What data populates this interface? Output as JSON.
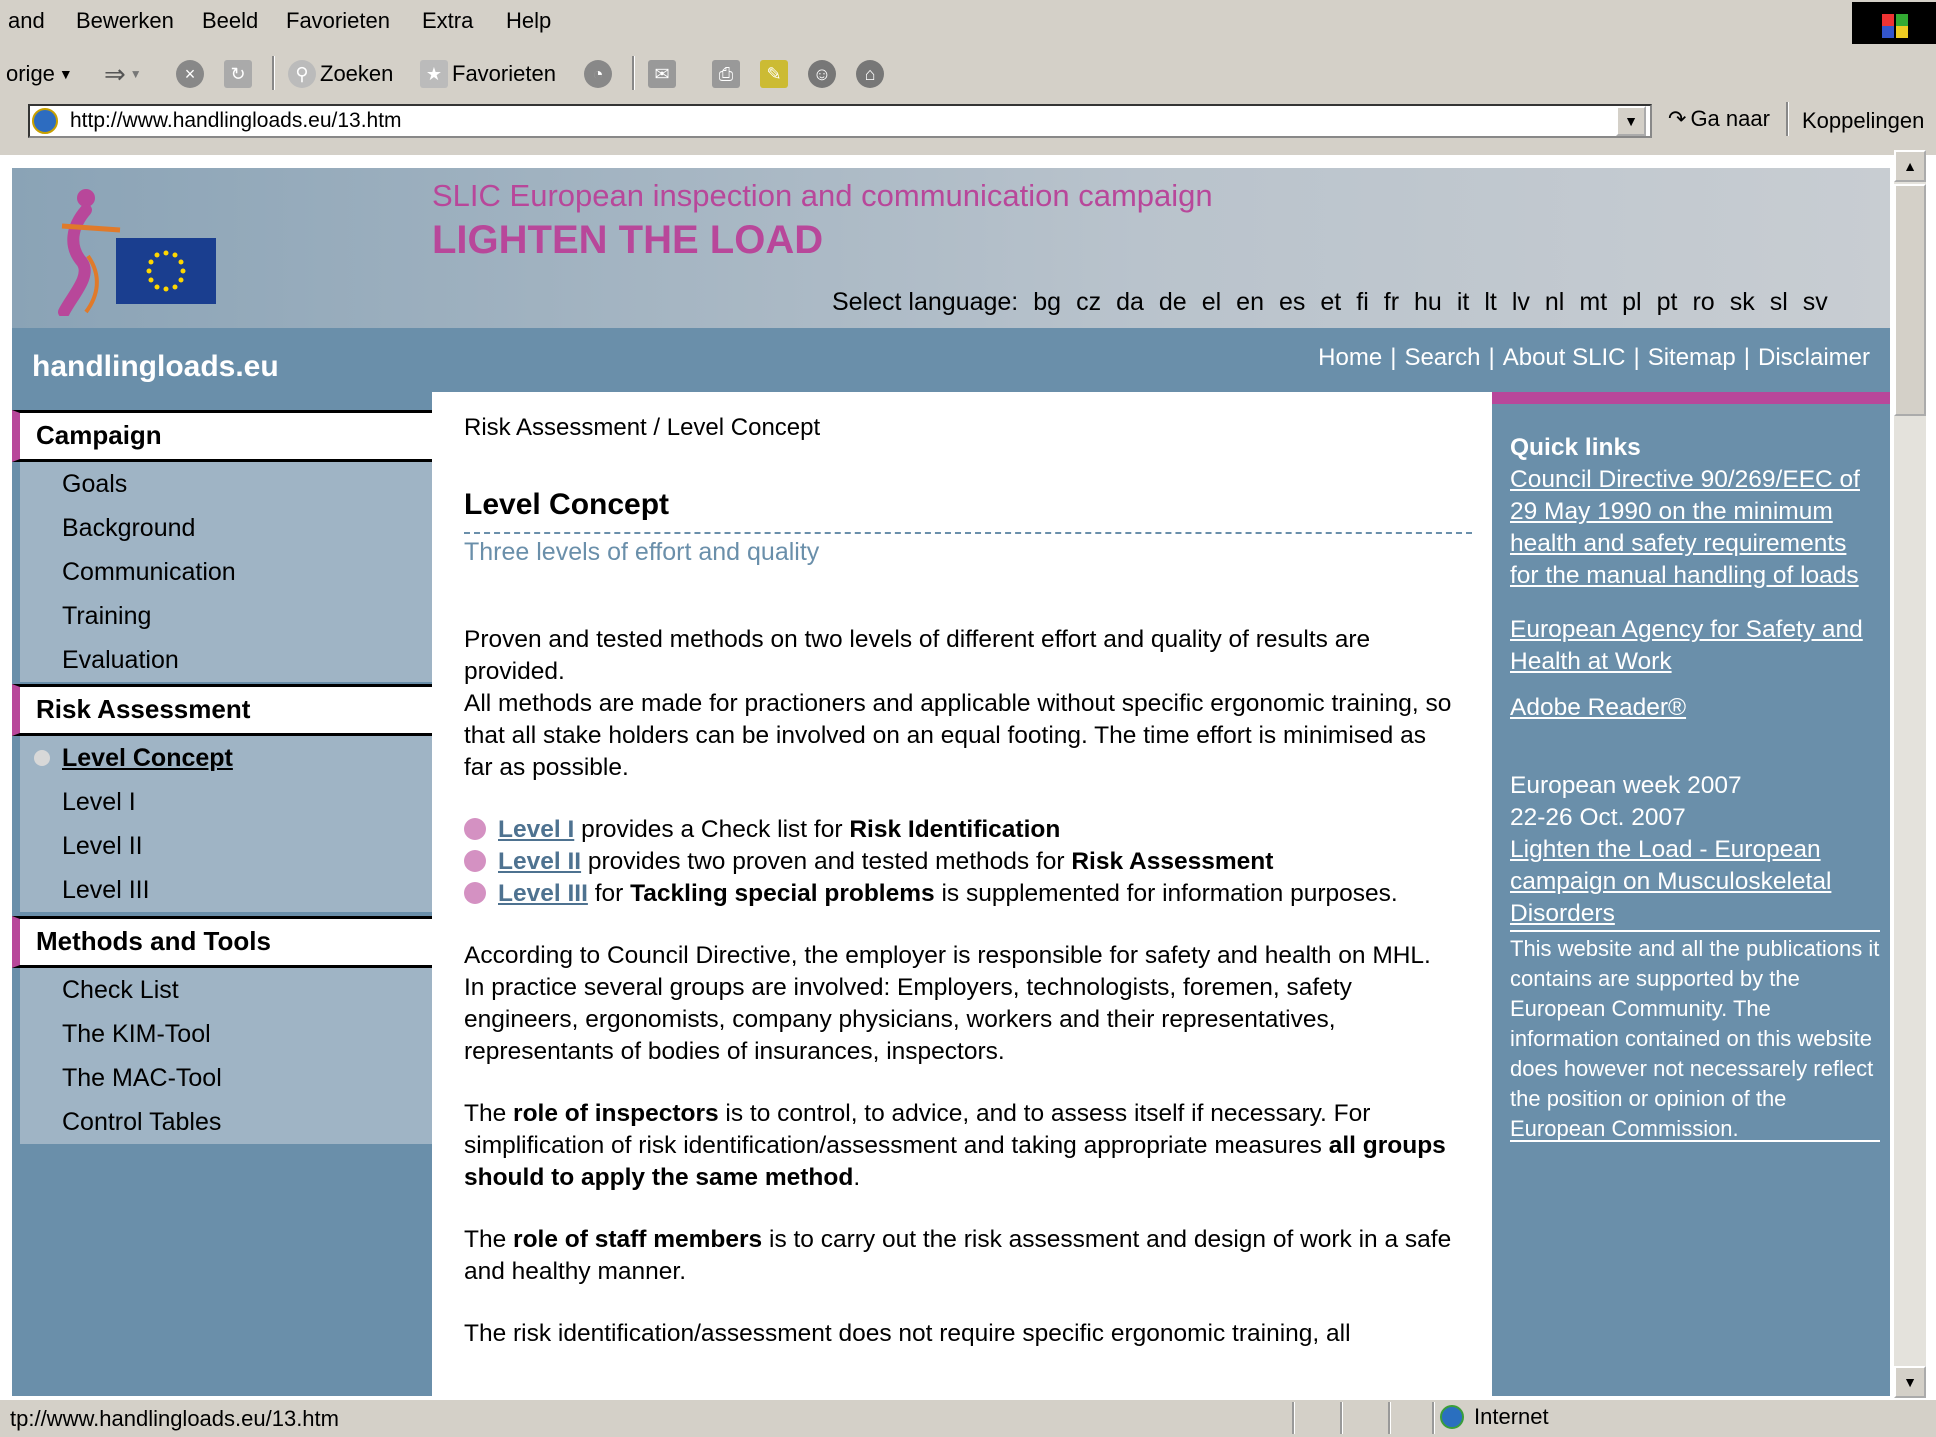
{
  "browser": {
    "menu": [
      "and",
      "Bewerken",
      "Beeld",
      "Favorieten",
      "Extra",
      "Help"
    ],
    "toolbar": {
      "back": "orige",
      "search": "Zoeken",
      "favorites": "Favorieten"
    },
    "address": "http://www.handlingloads.eu/13.htm",
    "go": "Ga naar",
    "links": "Koppelingen",
    "status_url": "tp://www.handlingloads.eu/13.htm",
    "zone": "Internet"
  },
  "header": {
    "line1": "SLIC European inspection and communication campaign",
    "line2": "LIGHTEN THE LOAD",
    "select_language": "Select language:",
    "languages": [
      "bg",
      "cz",
      "da",
      "de",
      "el",
      "en",
      "es",
      "et",
      "fi",
      "fr",
      "hu",
      "it",
      "lt",
      "lv",
      "nl",
      "mt",
      "pl",
      "pt",
      "ro",
      "sk",
      "sl",
      "sv"
    ]
  },
  "site": {
    "name": "handlingloads.eu",
    "nav": [
      "Home",
      "Search",
      "About SLIC",
      "Sitemap",
      "Disclaimer"
    ]
  },
  "sidebar": {
    "sections": [
      {
        "title": "Campaign",
        "items": [
          "Goals",
          "Background",
          "Communication",
          "Training",
          "Evaluation"
        ]
      },
      {
        "title": "Risk Assessment",
        "items": [
          "Level Concept",
          "Level I",
          "Level II",
          "Level III"
        ],
        "active": "Level Concept"
      },
      {
        "title": "Methods and Tools",
        "items": [
          "Check List",
          "The KIM-Tool",
          "The MAC-Tool",
          "Control Tables"
        ]
      }
    ]
  },
  "main": {
    "breadcrumb": "Risk Assessment / Level Concept",
    "title": "Level Concept",
    "subtitle": "Three levels of effort and quality",
    "p1": "Proven and tested methods on two levels of different effort and quality of results are provided.",
    "p1b": "All methods are made for practioners and applicable without specific ergonomic training, so that all stake holders can be involved on an equal footing. The time effort is minimised as far as possible.",
    "levels": [
      {
        "link": "Level I",
        "text": " provides a Check list for ",
        "bold": "Risk Identification",
        "tail": ""
      },
      {
        "link": "Level II",
        "text": " provides two proven and tested methods for ",
        "bold": "Risk Assessment",
        "tail": ""
      },
      {
        "link": "Level III",
        "text": " for ",
        "bold": "Tackling special problems",
        "tail": " is supplemented for information purposes."
      }
    ],
    "p2": "According to Council Directive, the employer is responsible for safety and health on MHL. In practice several groups are involved: Employers, technologists, foremen, safety engineers, ergonomists, company physicians, workers and their representatives, representants of bodies of insurances, inspectors.",
    "p3a": "The ",
    "p3b": "role of inspectors",
    "p3c": " is to control, to advice, and to assess itself if necessary. For simplification of risk identification/assessment and taking appropriate measures ",
    "p3d": "all groups should to apply the same method",
    "p3e": ".",
    "p4a": "The ",
    "p4b": "role of staff members",
    "p4c": " is to carry out the risk assessment and design of work in a safe and healthy manner.",
    "p5": "The risk identification/assessment does not require specific ergonomic training, all"
  },
  "right": {
    "quick_title": "Quick links",
    "link1": "Council Directive 90/269/EEC of 29 May 1990 on the minimum health and safety requirements for the manual handling of loads",
    "link2": "European Agency for Safety and Health at Work",
    "link3": "Adobe Reader®",
    "week1": "European week 2007",
    "week2": "22-26 Oct. 2007",
    "link4": "Lighten the Load - European campaign on Musculoskeletal Disorders",
    "disclaimer": "This website and all the publications it contains are supported by the European Community. The information contained on this website does however not necessarely reflect the position or opinion of the European Commission."
  }
}
